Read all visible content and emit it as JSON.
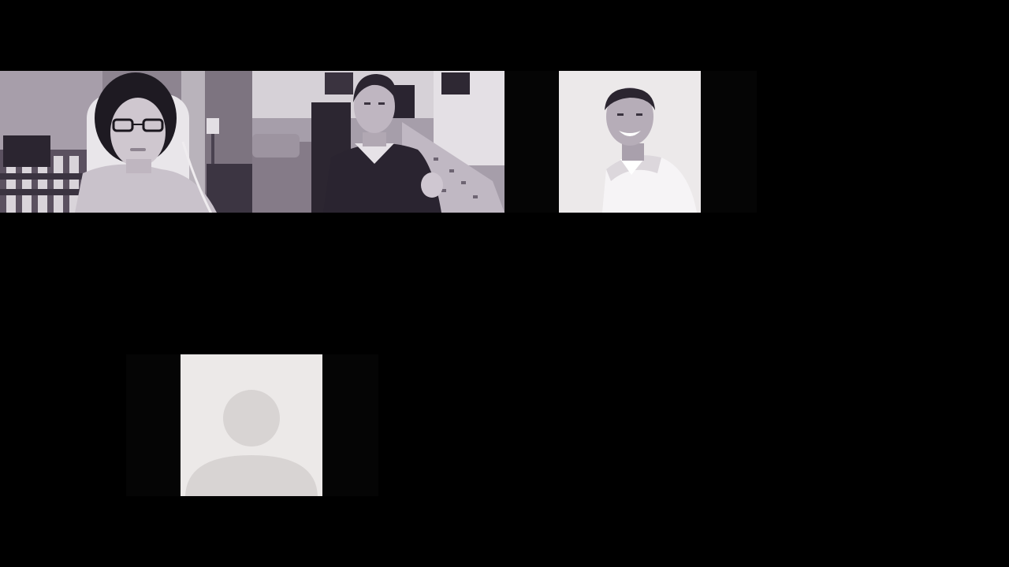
{
  "app": {
    "view": "gallery"
  },
  "colors": {
    "background": "#000000",
    "letterbox": "#050505",
    "placeholder_bg": "#ece9e8",
    "placeholder_fg": "#d8d4d3"
  },
  "participants": [
    {
      "id": 1,
      "video": "on",
      "avatar": "woman-with-glasses-video"
    },
    {
      "id": 2,
      "video": "on",
      "avatar": "man-in-sweater-video"
    },
    {
      "id": 3,
      "video": "photo",
      "avatar": "smiling-man-photo"
    },
    {
      "id": 4,
      "video": "off",
      "avatar": "default-person-silhouette"
    }
  ]
}
